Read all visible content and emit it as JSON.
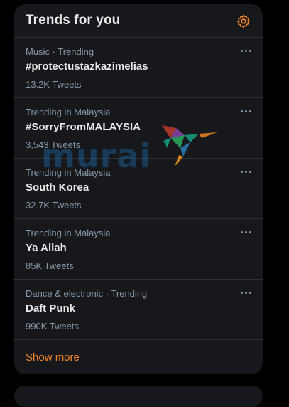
{
  "panel": {
    "title": "Trends for you",
    "gear_icon": "gear-icon",
    "accent_color": "#f4842a"
  },
  "trends": [
    {
      "meta": "Music · Trending",
      "name": "#protectustazkazimelias",
      "count": "13.2K Tweets"
    },
    {
      "meta": "Trending in Malaysia",
      "name": "#SorryFromMALAYSIA",
      "count": "3,543 Tweets"
    },
    {
      "meta": "Trending in Malaysia",
      "name": "South Korea",
      "count": "32.7K Tweets"
    },
    {
      "meta": "Trending in Malaysia",
      "name": "Ya Allah",
      "count": "85K Tweets"
    },
    {
      "meta": "Dance & electronic · Trending",
      "name": "Daft Punk",
      "count": "990K Tweets"
    }
  ],
  "show_more": "Show more",
  "watermark": {
    "text": "murai"
  }
}
